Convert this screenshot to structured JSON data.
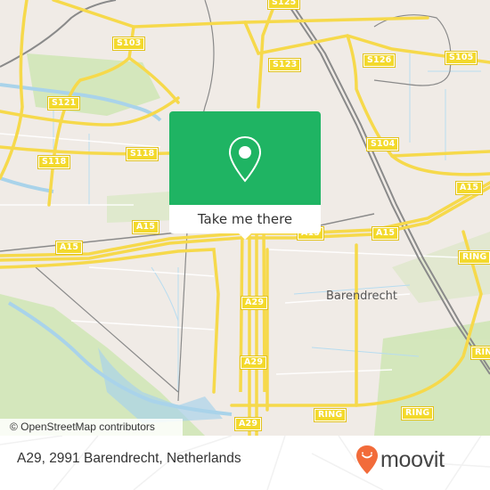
{
  "map": {
    "road_shields": [
      {
        "label": "S125",
        "id": "s125"
      },
      {
        "label": "S103",
        "id": "s103"
      },
      {
        "label": "S123",
        "id": "s123"
      },
      {
        "label": "S126",
        "id": "s126"
      },
      {
        "label": "S105",
        "id": "s105"
      },
      {
        "label": "S121",
        "id": "s121"
      },
      {
        "label": "S118",
        "id": "s118-a"
      },
      {
        "label": "S118",
        "id": "s118-b"
      },
      {
        "label": "S104",
        "id": "s104"
      },
      {
        "label": "A15",
        "id": "a15-a"
      },
      {
        "label": "A15",
        "id": "a15-b"
      },
      {
        "label": "A15",
        "id": "a15-c"
      },
      {
        "label": "A15",
        "id": "a15-d"
      },
      {
        "label": "A15",
        "id": "a15-e"
      },
      {
        "label": "RING",
        "id": "ring-a"
      },
      {
        "label": "RING",
        "id": "ring-b"
      },
      {
        "label": "RING",
        "id": "ring-c"
      },
      {
        "label": "RING",
        "id": "ring-d"
      },
      {
        "label": "A29",
        "id": "a29-a"
      },
      {
        "label": "A29",
        "id": "a29-b"
      },
      {
        "label": "A29",
        "id": "a29-c"
      }
    ],
    "place_label": "Barendrecht",
    "attribution": "© OpenStreetMap contributors"
  },
  "popup": {
    "icon": "location-pin-icon",
    "button_label": "Take me there",
    "color": "#1fb463"
  },
  "footer": {
    "address": "A29, 2991 Barendrecht, Netherlands",
    "brand": "moovit",
    "brand_color": "#f26b3a"
  }
}
